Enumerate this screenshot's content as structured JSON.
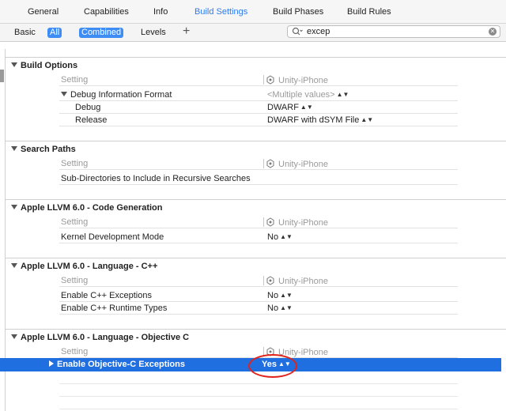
{
  "tabs": [
    {
      "label": "General",
      "active": false
    },
    {
      "label": "Capabilities",
      "active": false
    },
    {
      "label": "Info",
      "active": false
    },
    {
      "label": "Build Settings",
      "active": true
    },
    {
      "label": "Build Phases",
      "active": false
    },
    {
      "label": "Build Rules",
      "active": false
    }
  ],
  "filter": {
    "basic": "Basic",
    "all": "All",
    "combined": "Combined",
    "levels": "Levels",
    "add": "+"
  },
  "search": {
    "value": "excep"
  },
  "header": {
    "setting": "Setting",
    "target": "Unity-iPhone"
  },
  "sections": {
    "build_options": {
      "title": "Build Options",
      "debug_format": "Debug Information Format",
      "multiple": "<Multiple values>",
      "debug": "Debug",
      "debug_value": "DWARF",
      "release": "Release",
      "release_value": "DWARF with dSYM File"
    },
    "search_paths": {
      "title": "Search Paths",
      "subdirs": "Sub-Directories to Include in Recursive Searches"
    },
    "codegen": {
      "title": "Apple LLVM 6.0 - Code Generation",
      "kernel": "Kernel Development Mode",
      "kernel_value": "No"
    },
    "cpp": {
      "title": "Apple LLVM 6.0 - Language - C++",
      "exceptions": "Enable C++ Exceptions",
      "exceptions_value": "No",
      "rtti": "Enable C++ Runtime Types",
      "rtti_value": "No"
    },
    "objc": {
      "title": "Apple LLVM 6.0 - Language - Objective C",
      "exceptions": "Enable Objective-C Exceptions",
      "exceptions_value": "Yes"
    }
  },
  "colors": {
    "accent": "#2d7bf0",
    "selection": "#1f6fe0",
    "annotation": "#e0231b"
  }
}
